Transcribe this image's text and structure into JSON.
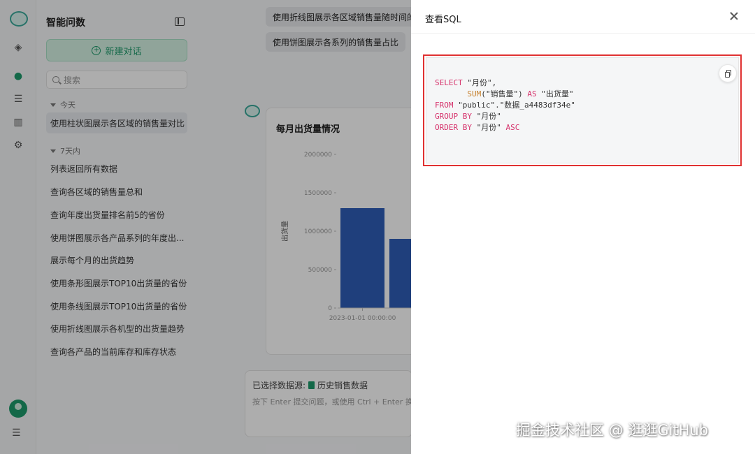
{
  "sidebar": {
    "title": "智能问数",
    "new_chat_label": "新建对话",
    "search_placeholder": "搜索",
    "groups": [
      {
        "label": "今天",
        "items": [
          "使用柱状图展示各区域的销售量对比"
        ]
      },
      {
        "label": "7天内",
        "items": [
          "列表返回所有数据",
          "查询各区域的销售量总和",
          "查询年度出货量排名前5的省份",
          "使用饼图展示各产品系列的年度出...",
          "展示每个月的出货趋势",
          "使用条形图展示TOP10出货量的省份",
          "使用条线图展示TOP10出货量的省份",
          "使用折线图展示各机型的出货量趋势",
          "查询各产品的当前库存和库存状态"
        ]
      }
    ]
  },
  "main": {
    "questions": [
      "使用折线图展示各区域销售量随时间的变",
      "使用饼图展示各系列的销售量占比"
    ],
    "chart_card_title": "每月出货量情况",
    "datasource_prefix": "已选择数据源:",
    "datasource_name": "历史销售数据",
    "input_hint": "按下 Enter 提交问题，或使用 Ctrl + Enter 换行"
  },
  "chart_data": {
    "type": "bar",
    "title": "每月出货量情况",
    "ylabel": "出货量",
    "xlabel": "",
    "ylim": [
      0,
      2000000
    ],
    "y_ticks": [
      "2000000",
      "1500000",
      "1000000",
      "500000",
      "0"
    ],
    "categories": [
      "2023-01-01 00:00:00",
      ""
    ],
    "values": [
      1300000,
      900000
    ]
  },
  "drawer": {
    "title": "查看SQL",
    "sql_lines": [
      [
        {
          "t": "SELECT",
          "c": "kw"
        },
        {
          "t": " \"月份\",",
          "c": ""
        }
      ],
      [
        {
          "t": "       ",
          "c": ""
        },
        {
          "t": "SUM",
          "c": "fn"
        },
        {
          "t": "(\"销售量\") ",
          "c": ""
        },
        {
          "t": "AS",
          "c": "kw"
        },
        {
          "t": " \"出货量\"",
          "c": ""
        }
      ],
      [
        {
          "t": "FROM",
          "c": "kw"
        },
        {
          "t": " \"public\".\"数据_a4483df34e\"",
          "c": ""
        }
      ],
      [
        {
          "t": "GROUP BY",
          "c": "kw"
        },
        {
          "t": " \"月份\"",
          "c": ""
        }
      ],
      [
        {
          "t": "ORDER BY",
          "c": "kw"
        },
        {
          "t": " \"月份\" ",
          "c": ""
        },
        {
          "t": "ASC",
          "c": "kw"
        }
      ]
    ]
  },
  "watermark": "掘金技术社区 @ 逛逛GitHub",
  "colors": {
    "accent": "#1c9a6a",
    "bar": "#2f5db7",
    "highlight": "#e03131",
    "keyword": "#d6336c"
  }
}
